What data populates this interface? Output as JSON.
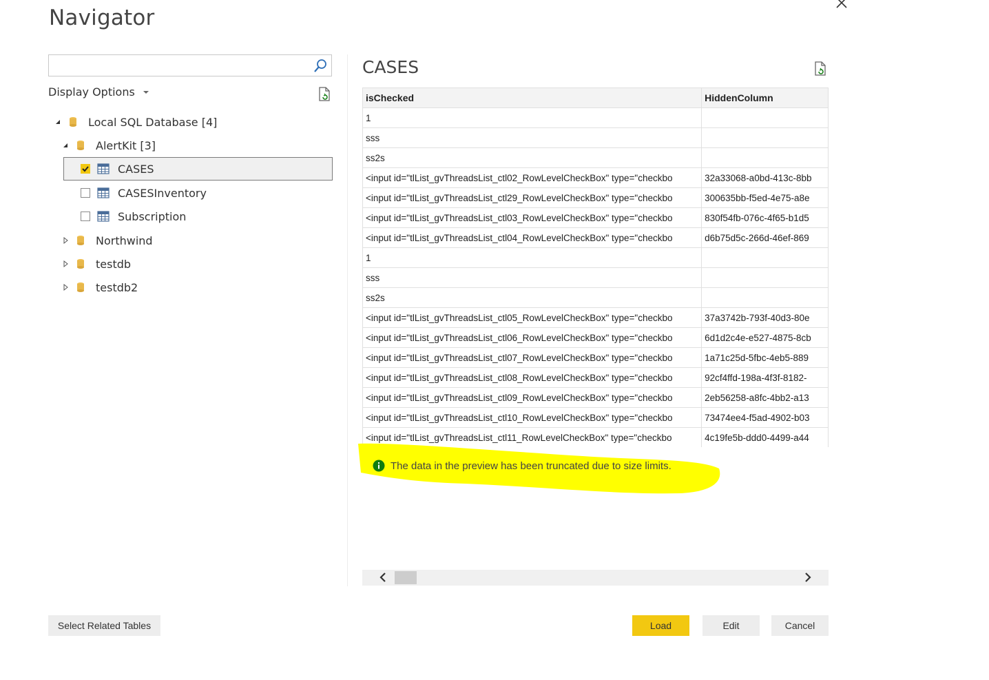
{
  "window": {
    "title": "Navigator"
  },
  "search": {
    "placeholder": "",
    "value": ""
  },
  "display_options": {
    "label": "Display Options"
  },
  "tree": {
    "root": {
      "label": "Local SQL Database [4]"
    },
    "alertkit": {
      "label": "AlertKit [3]"
    },
    "tables": [
      {
        "label": "CASES",
        "checked": true
      },
      {
        "label": "CASESInventory",
        "checked": false
      },
      {
        "label": "Subscription",
        "checked": false
      }
    ],
    "databases": [
      {
        "label": "Northwind"
      },
      {
        "label": "testdb"
      },
      {
        "label": "testdb2"
      }
    ]
  },
  "preview": {
    "title": "CASES",
    "columns": [
      "isChecked",
      "HiddenColumn"
    ],
    "rows": [
      [
        "1",
        ""
      ],
      [
        "sss",
        ""
      ],
      [
        "ss2s",
        ""
      ],
      [
        "<input id=\"tlList_gvThreadsList_ctl02_RowLevelCheckBox\" type=\"checkbo",
        "32a33068-a0bd-413c-8bb"
      ],
      [
        "<input id=\"tlList_gvThreadsList_ctl29_RowLevelCheckBox\" type=\"checkbo",
        "300635bb-f5ed-4e75-a8e"
      ],
      [
        "<input id=\"tlList_gvThreadsList_ctl03_RowLevelCheckBox\" type=\"checkbo",
        "830f54fb-076c-4f65-b1d5"
      ],
      [
        "<input id=\"tlList_gvThreadsList_ctl04_RowLevelCheckBox\" type=\"checkbo",
        "d6b75d5c-266d-46ef-869"
      ],
      [
        "1",
        ""
      ],
      [
        "sss",
        ""
      ],
      [
        "ss2s",
        ""
      ],
      [
        "<input id=\"tlList_gvThreadsList_ctl05_RowLevelCheckBox\" type=\"checkbo",
        "37a3742b-793f-40d3-80e"
      ],
      [
        "<input id=\"tlList_gvThreadsList_ctl06_RowLevelCheckBox\" type=\"checkbo",
        "6d1d2c4e-e527-4875-8cb"
      ],
      [
        "<input id=\"tlList_gvThreadsList_ctl07_RowLevelCheckBox\" type=\"checkbo",
        "1a71c25d-5fbc-4eb5-889"
      ],
      [
        "<input id=\"tlList_gvThreadsList_ctl08_RowLevelCheckBox\" type=\"checkbo",
        "92cf4ffd-198a-4f3f-8182-"
      ],
      [
        "<input id=\"tlList_gvThreadsList_ctl09_RowLevelCheckBox\" type=\"checkbo",
        "2eb56258-a8fc-4bb2-a13"
      ],
      [
        "<input id=\"tlList_gvThreadsList_ctl10_RowLevelCheckBox\" type=\"checkbo",
        "73474ee4-f5ad-4902-b03"
      ],
      [
        "<input id=\"tlList_gvThreadsList_ctl11_RowLevelCheckBox\" type=\"checkbo",
        "4c19fe5b-ddd0-4499-a44"
      ]
    ],
    "notice": "The data in the preview has been truncated due to size limits."
  },
  "buttons": {
    "select_related": "Select Related Tables",
    "load": "Load",
    "edit": "Edit",
    "cancel": "Cancel"
  },
  "colors": {
    "accent": "#f2c811",
    "highlight": "#ffff00",
    "info": "#107c10",
    "db_icon": "#e8b84b",
    "table_icon": "#4a6d99"
  }
}
